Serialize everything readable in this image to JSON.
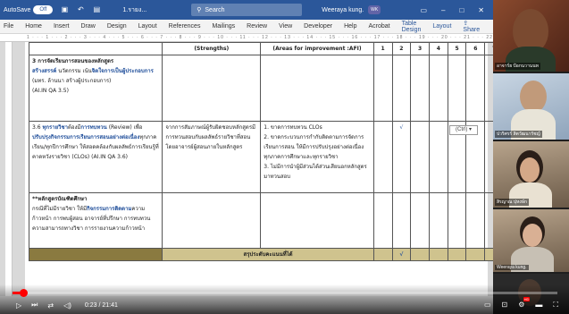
{
  "word": {
    "autosave_label": "AutoSave",
    "autosave_state": "Off",
    "doc_title": "1.รายง...",
    "search_placeholder": "Search",
    "user_name": "Weeraya kung.",
    "user_initials": "WK",
    "menu": [
      "File",
      "Home",
      "Insert",
      "Draw",
      "Design",
      "Layout",
      "References",
      "Mailings",
      "Review",
      "View",
      "Developer",
      "Help",
      "Acrobat",
      "Table Design",
      "Layout"
    ],
    "share_label": "Share",
    "ruler_text": "1 · · · 1 · · · 2 · · · 3 · · · 4 · · · 5 · · · 6 · · · 7 · · · 8 · · · 9 · · · 10 · · · 11 · · · 12 · · · 13 · · · 14 · · · 15 · · · 16 · · · 17 · · · 18 · · · 19 · · · 20 · · · 21 · · · 22 · · · 23 · · · 24 · · · 25 · · · 26"
  },
  "table": {
    "header": {
      "strengths": "(Strengths)",
      "improvement": "(Areas for improvement :AFI)"
    },
    "score_cols": [
      "1",
      "2",
      "3",
      "4",
      "5",
      "6",
      "7"
    ],
    "row_section": {
      "title": "3 การจัดเรียนการสอนของหลักสูตร",
      "sub_bold_1": "สร้างสรรค์",
      "sub_1": " นวัตกรรม เน้น",
      "sub_bold_2": "จิตใจการเป็นผู้ประกอบการ",
      "sub_2": "(มทร. ล้านนา สร้างผู้ประกอบการ)",
      "ref": "(AI.IN QA 3.5)"
    },
    "row_36": {
      "c1_pre": "3.6 ",
      "c1_bold": "ทุกรายวิชา",
      "c1_a": "ต้องมี",
      "c1_bold2": "การทบทวน",
      "c1_b": " (Review) เพื่อ",
      "c1_bold3": "ปรับปรุงกิจกรรมการเรียนการสอนอย่างต่อเนื่อง",
      "c1_c": "ทุกภาคเรียน/ทุกปีการศึกษา ให้สอดคล้องกับผลลัพธ์การเรียนรู้ที่คาดหวังรายวิชา (CLOs) (AI.IN QA 3.6)",
      "c2": "จากการสัมภาษณ์ผู้รับผิดชอบหลักสูตรมีการทวนสอบกับผลลัพธ์รายวิชาที่สอนโดยอาจารย์ผู้สอนภายในหลักสูตร",
      "c3": "1. ขาดการทบทวน CLOs\n2. ขาดกระบวนการกำกับติดตามการจัดการเรียนการสอน ให้มีการปรับปรุงอย่างต่อเนื่อง ทุกภาคการศึกษาและทุกรายวิชา\n3. ไม่มีการนำผู้มีส่วนได้ส่วนเสียนอกหลักสูตรมาทวนสอบ",
      "check": "√",
      "ctrl_chip": "(Ctrl) ▾"
    },
    "row_grad": {
      "title": "**หลักสูตรบัณฑิตศึกษา",
      "c1_a": "กรณีที่ไม่มีรายวิชา ให้มี",
      "c1_bold": "กิจกรรมการติดตาม",
      "c1_b": "ความก้าวหน้า การพบผู้สอน อาจารย์ที่ปรึกษา การทบทวนความสามารถทางวิชา การรายงานความก้าวหน้า"
    },
    "summary": {
      "label": "สรุประดับคะแนนที่ได้",
      "check": "√"
    }
  },
  "video": {
    "progress_fraction": 0.0192,
    "time": "0:23 / 21:41",
    "icons": [
      "play-icon",
      "next-icon",
      "shuffle-icon",
      "volume-icon"
    ]
  },
  "participants": [
    {
      "name": "อาจาร์ย ป้อกนวานนท",
      "bg": "red"
    },
    {
      "name": "ปวริศรร์ สิตวัฒนารัชญ์",
      "bg": "blue"
    },
    {
      "name": "สิรญาณ ปุหงษ์ก",
      "bg": "room"
    },
    {
      "name": "Weeraya kung.",
      "bg": "room"
    }
  ],
  "colors": {
    "word_blue": "#2b579a",
    "summary_gold": "#cfc38e",
    "progress_red": "#ff0000"
  }
}
